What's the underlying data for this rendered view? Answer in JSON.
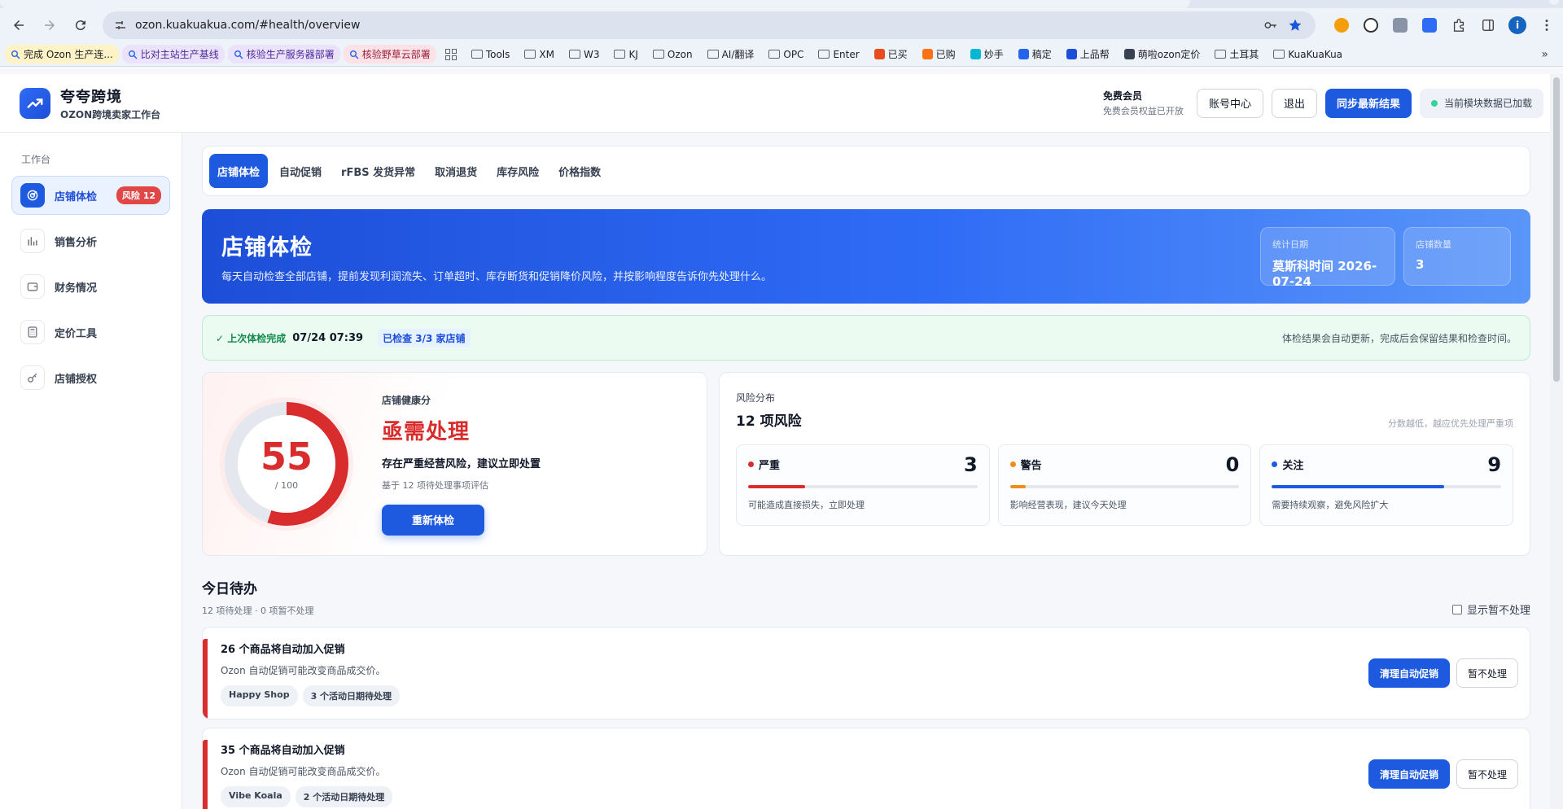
{
  "browser": {
    "url": "ozon.kuakuakua.com/#health/overview",
    "bookmarks": [
      {
        "label": "完成 Ozon 生产连...",
        "style": "pill-yellow"
      },
      {
        "label": "比对主站生产基线",
        "style": "pill-purple"
      },
      {
        "label": "核验生产服务器部署",
        "style": "pill-purple"
      },
      {
        "label": "核验野草云部署",
        "style": "pill-pink"
      },
      {
        "label": "Tools",
        "style": "folder"
      },
      {
        "label": "XM",
        "style": "folder"
      },
      {
        "label": "W3",
        "style": "folder"
      },
      {
        "label": "KJ",
        "style": "folder"
      },
      {
        "label": "Ozon",
        "style": "folder"
      },
      {
        "label": "AI/翻译",
        "style": "folder"
      },
      {
        "label": "OPC",
        "style": "folder"
      },
      {
        "label": "Enter",
        "style": "folder"
      },
      {
        "label": "已买",
        "style": "site"
      },
      {
        "label": "已购",
        "style": "site"
      },
      {
        "label": "妙手",
        "style": "site"
      },
      {
        "label": "稿定",
        "style": "site"
      },
      {
        "label": "上品帮",
        "style": "site"
      },
      {
        "label": "萌啦ozon定价",
        "style": "site"
      },
      {
        "label": "土耳其",
        "style": "folder"
      },
      {
        "label": "KuaKuaKua",
        "style": "folder"
      }
    ],
    "more": "»",
    "profile_initial": "i"
  },
  "header": {
    "brand_name": "夸夸跨境",
    "brand_sub": "OZON跨境卖家工作台",
    "member_title": "免费会员",
    "member_sub": "免费会员权益已开放",
    "account_btn": "账号中心",
    "logout_btn": "退出",
    "sync_btn": "同步最新结果",
    "status_text": "当前模块数据已加载"
  },
  "sidebar": {
    "section": "工作台",
    "items": [
      {
        "label": "店铺体检",
        "badge": "风险 12",
        "icon": "target-icon",
        "active": true
      },
      {
        "label": "销售分析",
        "icon": "bar-chart-icon"
      },
      {
        "label": "财务情况",
        "icon": "wallet-icon"
      },
      {
        "label": "定价工具",
        "icon": "calculator-icon"
      },
      {
        "label": "店铺授权",
        "icon": "key-icon"
      }
    ]
  },
  "tabs": [
    "店铺体检",
    "自动促销",
    "rFBS 发货异常",
    "取消退货",
    "库存风险",
    "价格指数"
  ],
  "hero": {
    "title": "店铺体检",
    "desc": "每天自动检查全部店铺，提前发现利润流失、订单超时、库存断货和促销降价风险，并按影响程度告诉你先处理什么。",
    "stat_date_label": "统计日期",
    "stat_date_value": "莫斯科时间 2026-07-24",
    "stat_shops_label": "店铺数量",
    "stat_shops_value": "3"
  },
  "notice": {
    "ok": "✓ 上次体检完成",
    "time": "07/24 07:39",
    "checked": "已检查 3/3 家店铺",
    "right": "体检结果会自动更新，完成后会保留结果和检查时间。"
  },
  "health": {
    "label": "店铺健康分",
    "score": "55",
    "score_value": 55,
    "max": "/ 100",
    "status": "亟需处理",
    "desc": "存在严重经营风险，建议立即处置",
    "note": "基于 12 项待处理事项评估",
    "button": "重新体检",
    "ring_color": "#d92d2d"
  },
  "risk": {
    "label": "风险分布",
    "title": "12 项风险",
    "hint": "分数越低，越应优先处理严重项",
    "items": [
      {
        "name": "严重",
        "count": "3",
        "desc": "可能造成直接损失，立即处理",
        "color": "#d92d2d",
        "fill": 0.25
      },
      {
        "name": "警告",
        "count": "0",
        "desc": "影响经营表现，建议今天处理",
        "color": "#f08c1a",
        "fill": 0.07
      },
      {
        "name": "关注",
        "count": "9",
        "desc": "需要持续观察，避免风险扩大",
        "color": "#1d5ae0",
        "fill": 0.75
      }
    ]
  },
  "todo": {
    "title": "今日待办",
    "sub": "12 项待处理 · 0 项暂不处理",
    "toggle": "显示暂不处理",
    "items": [
      {
        "title": "26 个商品将自动加入促销",
        "desc": "Ozon 自动促销可能改变商品成交价。",
        "tags": [
          "Happy Shop",
          "3 个活动日期待处理"
        ],
        "primary": "清理自动促销",
        "secondary": "暂不处理"
      },
      {
        "title": "35 个商品将自动加入促销",
        "desc": "Ozon 自动促销可能改变商品成交价。",
        "tags": [
          "Vibe Koala",
          "2 个活动日期待处理"
        ],
        "primary": "清理自动促销",
        "secondary": "暂不处理"
      }
    ]
  }
}
